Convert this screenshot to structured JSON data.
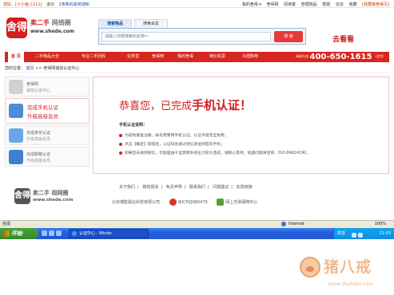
{
  "topbar": {
    "user": "您好，[小小鱼儿111]",
    "logout": "退出",
    "notice": "2条新的系统通知",
    "links": [
      "我的舍得 ▾",
      "舍得网",
      "阅读置",
      "管理物品",
      "帮助",
      "论坛",
      "收藏"
    ],
    "highlight": "[我要做舍得贝]"
  },
  "header": {
    "logo_mark": "舍得",
    "slogan_red": "卖二手",
    "slogan_grey": "网络圈",
    "url": "www.shede.com",
    "search_tabs": [
      "搜索物品",
      "搜索会友"
    ],
    "search_placeholder": "请输入你想搜索的名称～",
    "search_button": "搜 索",
    "promo": "去看看"
  },
  "nav": {
    "items": [
      "首 页",
      "二手物品大全",
      "专业二手回收",
      "任务堂",
      "舍得吧",
      "我的舍得",
      "特价机票",
      "众团购吧"
    ],
    "active_index": 0,
    "hotline_label": "网易在线",
    "hotline_number": "400-650-1615",
    "hotline_city": "（北京）"
  },
  "breadcrumb": {
    "prefix": "您的位置：",
    "home": "首页",
    "sep": ">>",
    "current": "舍得网诚信认证中心"
  },
  "sidebar": {
    "items": [
      {
        "title": "舍得网",
        "subtitle": "诚信认证中心",
        "icon": "certificate-icon",
        "color": "#d1d1d1"
      },
      {
        "title": "完成手机认证",
        "subtitle": "升级高级会员",
        "icon": "mobile-phone-icon",
        "color": "#4f8bd6"
      },
      {
        "title": "完成身份认证",
        "subtitle": "升级高级会员",
        "icon": "id-card-icon",
        "color": "#6aa5e8"
      },
      {
        "title": "完成邮箱认证",
        "subtitle": "升级高级会员",
        "icon": "envelope-icon",
        "color": "#3f7fd0"
      }
    ]
  },
  "main": {
    "headline_prefix": "恭喜您，已完成",
    "headline_bold": "手机认证！",
    "subheading": "手机认证说明：",
    "lines": [
      "为避免重复注册，帐号需要用手机认证，认证手续完全免费；",
      "点击【确定】按钮后，认证码会通过短信发送到您的手机；",
      "如果您未收到短信，可能是由于运营商系统压力较大造成，请耐心等待。如遇问题请咨询：010-84624190。"
    ]
  },
  "footer": {
    "links": [
      "关于我们",
      "媒体报道",
      "免责声明",
      "联系我们",
      "问题建议",
      "友情链接"
    ],
    "logo_mark": "舍得",
    "slogan": "卖二手 阅网圈",
    "url": "www.shede.com",
    "company": "北京博胜骏业科技有限公司",
    "icp": "京ICP证080470",
    "alarm": "网上交易保障中心"
  },
  "statusbar": {
    "status": "完成",
    "zone": "Internet",
    "zoom": "100%"
  },
  "taskbar": {
    "start": "开始",
    "task": "认证中心 - Windo",
    "lang": "拼音",
    "clock": "21:43"
  },
  "watermark": {
    "name": "猪八戒",
    "site": "www.zhubajie.com"
  }
}
